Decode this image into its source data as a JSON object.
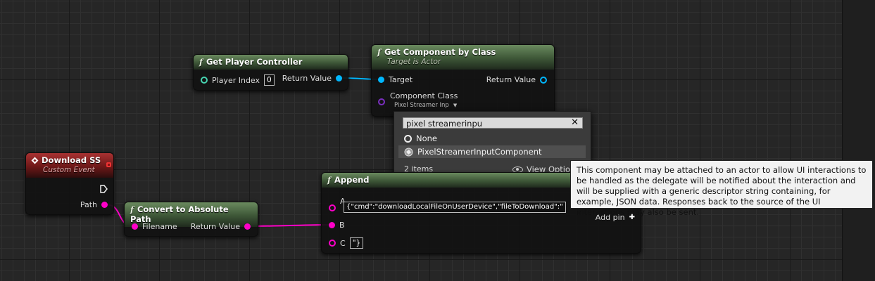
{
  "nodes": {
    "get_player_controller": {
      "title": "Get Player Controller",
      "func_glyph": "f",
      "player_index_label": "Player Index",
      "player_index_value": "0",
      "return_label": "Return Value"
    },
    "get_component_by_class": {
      "title": "Get Component by Class",
      "func_glyph": "f",
      "subtitle": "Target is Actor",
      "target_label": "Target",
      "return_label": "Return Value",
      "component_class_label": "Component Class",
      "component_class_value": "Pixel Streamer Inp"
    },
    "download_ss": {
      "title": "Download SS",
      "subtitle": "Custom Event",
      "path_label": "Path"
    },
    "convert_path": {
      "title": "Convert to Absolute Path",
      "func_glyph": "f",
      "filename_label": "Filename",
      "return_label": "Return Value"
    },
    "append": {
      "title": "Append",
      "func_glyph": "f",
      "a_label": "A",
      "a_value": "{\"cmd\":\"downloadLocalFileOnUserDevice\",\"fileToDownload\":\"",
      "b_label": "B",
      "c_label": "C",
      "c_value": "\"}",
      "add_pin_label": "Add pin",
      "add_pin_glyph": "✚"
    }
  },
  "class_picker": {
    "search_value": "pixel streamerinpu",
    "clear_glyph": "✕",
    "options": [
      {
        "label": "None",
        "icon": "radio-icon"
      },
      {
        "label": "PixelStreamerInputComponent",
        "icon": "component-icon",
        "selected": true
      }
    ],
    "item_count": "2 items",
    "view_options_label": "View Optio"
  },
  "tooltip": {
    "text": "This component may be attached to an actor to allow UI interactions to be handled as the delegate will be notified about the interaction and will be supplied with a generic descriptor string containing, for example, JSON data. Responses back to the source of the UI interactions may also be sent."
  },
  "colors": {
    "object_pin": "#00b7ff",
    "string_pin": "#ff00c8",
    "class_pin": "#7a2fbf",
    "func_header": "#3d5637",
    "event_header": "#6e1818"
  }
}
